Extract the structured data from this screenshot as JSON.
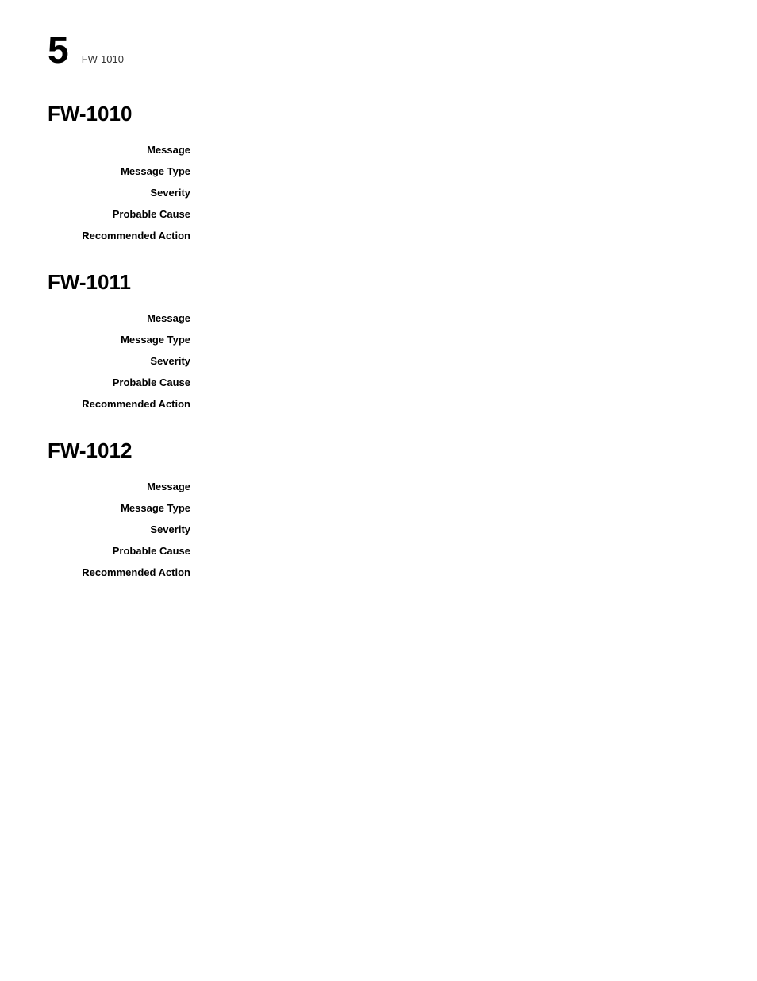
{
  "header": {
    "page_number": "5",
    "page_title": "FW-1010"
  },
  "sections": [
    {
      "id": "fw-1010",
      "title": "FW-1010",
      "fields": [
        {
          "label": "Message",
          "value": ""
        },
        {
          "label": "Message Type",
          "value": ""
        },
        {
          "label": "Severity",
          "value": ""
        },
        {
          "label": "Probable Cause",
          "value": ""
        },
        {
          "label": "Recommended Action",
          "value": ""
        }
      ]
    },
    {
      "id": "fw-1011",
      "title": "FW-1011",
      "fields": [
        {
          "label": "Message",
          "value": ""
        },
        {
          "label": "Message Type",
          "value": ""
        },
        {
          "label": "Severity",
          "value": ""
        },
        {
          "label": "Probable Cause",
          "value": ""
        },
        {
          "label": "Recommended Action",
          "value": ""
        }
      ]
    },
    {
      "id": "fw-1012",
      "title": "FW-1012",
      "fields": [
        {
          "label": "Message",
          "value": ""
        },
        {
          "label": "Message Type",
          "value": ""
        },
        {
          "label": "Severity",
          "value": ""
        },
        {
          "label": "Probable Cause",
          "value": ""
        },
        {
          "label": "Recommended Action",
          "value": ""
        }
      ]
    }
  ]
}
